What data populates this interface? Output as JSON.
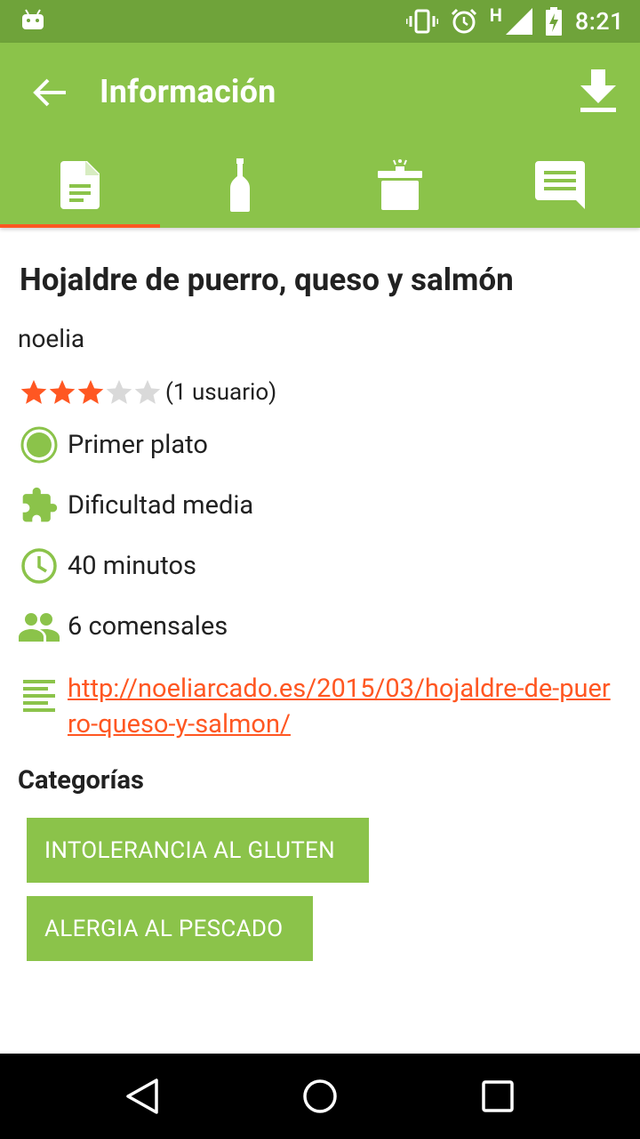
{
  "status_bar": {
    "time": "8:21",
    "network_label": "H",
    "icons": [
      "android-debug-icon",
      "vibrate-icon",
      "alarm-icon",
      "signal-icon",
      "battery-charging-icon"
    ]
  },
  "app_bar": {
    "title": "Información",
    "back_icon": "arrow-back-icon",
    "action_icon": "download-icon"
  },
  "tabs": [
    {
      "icon": "document-icon",
      "active": true
    },
    {
      "icon": "bottle-icon",
      "active": false
    },
    {
      "icon": "pot-icon",
      "active": false
    },
    {
      "icon": "comment-icon",
      "active": false
    }
  ],
  "recipe": {
    "title": "Hojaldre de puerro, queso y salmón",
    "author": "noelia",
    "rating": {
      "value": 3,
      "max": 5,
      "count_text": "(1 usuario)"
    },
    "course": "Primer plato",
    "difficulty": "Dificultad media",
    "time": "40 minutos",
    "servings": "6 comensales",
    "source_url": "http://noeliarcado.es/2015/03/hojaldre-de-puerro-queso-y-salmon/"
  },
  "categories": {
    "heading": "Categorías",
    "items": [
      "INTOLERANCIA AL GLUTEN",
      "ALERGIA AL PESCADO"
    ]
  },
  "colors": {
    "primary": "#8bc34a",
    "primary_dark": "#6fa33a",
    "accent": "#ff5722",
    "star_empty": "#d9d9d9"
  }
}
